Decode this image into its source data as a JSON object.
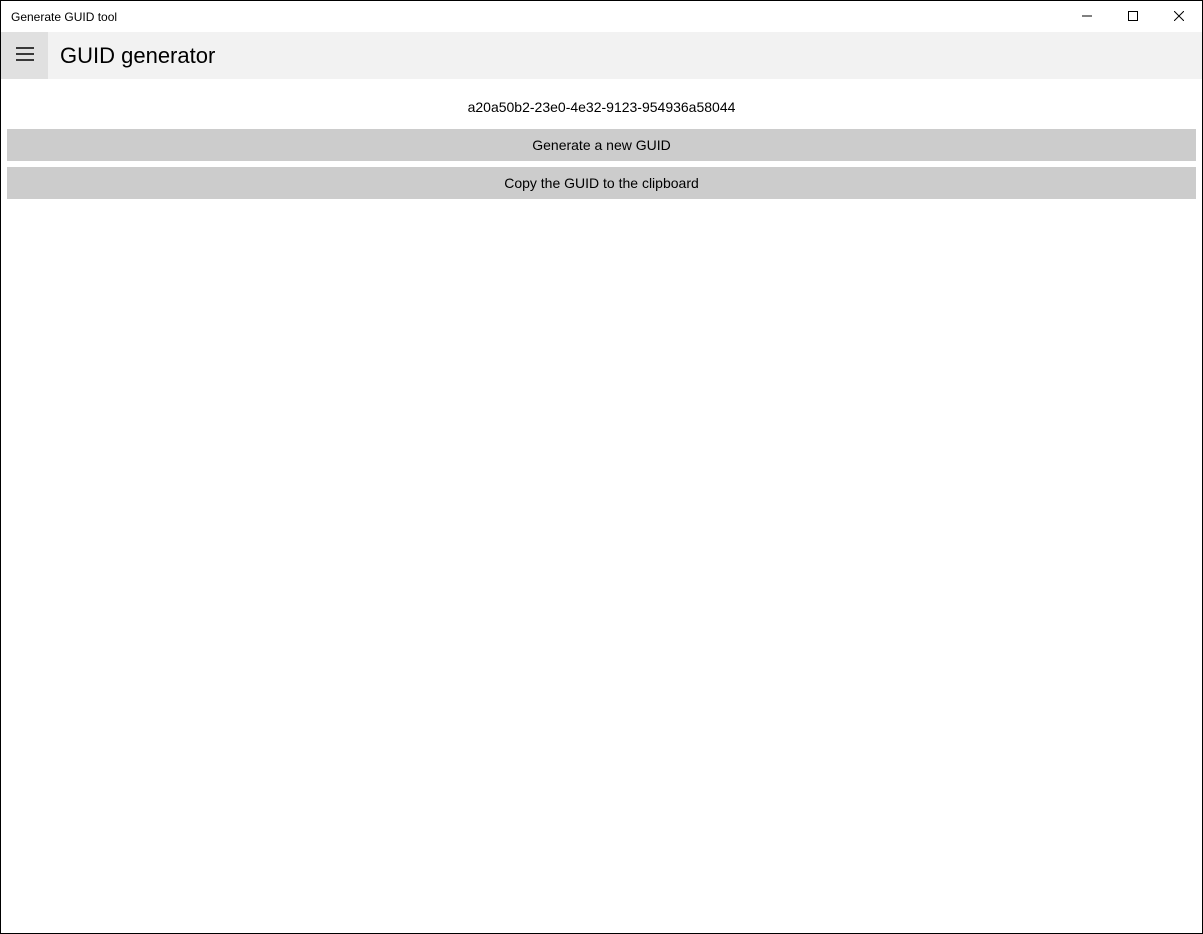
{
  "window": {
    "title": "Generate GUID tool"
  },
  "header": {
    "title": "GUID generator"
  },
  "main": {
    "guid_value": "a20a50b2-23e0-4e32-9123-954936a58044",
    "generate_button_label": "Generate a new GUID",
    "copy_button_label": "Copy the GUID to the clipboard"
  }
}
